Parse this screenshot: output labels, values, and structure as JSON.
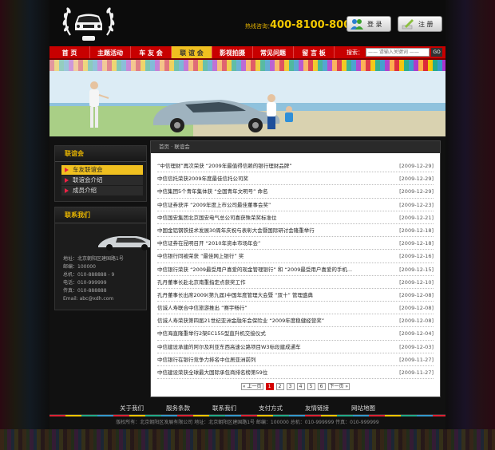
{
  "header": {
    "hotline_label": "热线咨询：",
    "hotline_number": "400-8100-8000",
    "login_label": "登 录",
    "register_label": "注 册",
    "logo_badge": "XDH"
  },
  "nav": {
    "items": [
      {
        "label": "首 页",
        "active": false
      },
      {
        "label": "主题活动",
        "active": false
      },
      {
        "label": "车 友 会",
        "active": false
      },
      {
        "label": "联 谊 会",
        "active": true
      },
      {
        "label": "影视拍摄",
        "active": false
      },
      {
        "label": "常见问题",
        "active": false
      },
      {
        "label": "留 言 板",
        "active": false
      }
    ],
    "search_label": "搜索：",
    "search_placeholder": "—— 请输入关键词 ——",
    "search_button": "GO"
  },
  "sidebar": {
    "section_title": "联谊会",
    "items": [
      {
        "label": "车友联谊会",
        "active": true
      },
      {
        "label": "联谊会介绍",
        "active": false
      },
      {
        "label": "成员介绍",
        "active": false
      }
    ],
    "contact_title": "联系我们",
    "contact_lines": [
      "地址：北京朝阳区建国路1号",
      "邮编：100000",
      "总机：010-888888 - 9",
      "电话：010-999999",
      "传真：010-888888",
      "Email: abc@xdh.com"
    ]
  },
  "main": {
    "breadcrumb": "首页 · 联谊会",
    "news": [
      {
        "title": "“中信理财”再次荣获 “2009年最值得信赖的银行理财品牌”",
        "date": "[2009-12-29]"
      },
      {
        "title": "中信信托荣获2009年度最佳信托公司奖",
        "date": "[2009-12-29]"
      },
      {
        "title": "中信集团5个青年集体获 “全国青年文明号” 命名",
        "date": "[2009-12-29]"
      },
      {
        "title": "中信证券获评 “2009年度上市公司最佳董事会奖”",
        "date": "[2009-12-23]"
      },
      {
        "title": "中信国安集团北京国安电气总公司喜获殊荣奖标准位",
        "date": "[2009-12-21]"
      },
      {
        "title": "中国金铝钢铁技术发展30周年庆祝与表彰大会暨国际研讨会隆重举行",
        "date": "[2009-12-18]"
      },
      {
        "title": "中信证券在昆明召开 “2010年资本市场年会”",
        "date": "[2009-12-18]"
      },
      {
        "title": "中信银行同被荣获 “最佳网上银行” 奖",
        "date": "[2009-12-16]"
      },
      {
        "title": "中信银行荣获 “2009最受用户喜爱的现金管理银行” 和 “2009最受用户喜爱的手机...",
        "date": "[2009-12-15]"
      },
      {
        "title": "孔丹董事长赴北京南重指定点获奖工作",
        "date": "[2009-12-10]"
      },
      {
        "title": "孔丹董事长出席2009(第九届)中国年度管理大会暨 “双十” 管理盛典",
        "date": "[2009-12-08]"
      },
      {
        "title": "信诚人寿联合中信旅游推出 “赛宇畅行”",
        "date": "[2009-12-08]"
      },
      {
        "title": "信诚人寿荣获第四届21世纪亚洲金融年会保险业 “2009年度稳健经营奖”",
        "date": "[2009-12-08]"
      },
      {
        "title": "中信海直隆重举行2架EC155型直升机交接仪式",
        "date": "[2009-12-04]"
      },
      {
        "title": "中信建设承建的阿尔及利亚东西高速公路项目W3标段建成通车",
        "date": "[2009-12-03]"
      },
      {
        "title": "中信银行在银行竞争力排名中位居亚洲前列",
        "date": "[2009-11-27]"
      },
      {
        "title": "中信建设荣获全球最大国际承包商排名榜第59位",
        "date": "[2009-11-27]"
      }
    ],
    "pager": {
      "prev": "« 上一页",
      "pages": [
        "1",
        "2",
        "3",
        "4",
        "5",
        "6"
      ],
      "current": "1",
      "next": "下一页 »"
    }
  },
  "footer": {
    "links": [
      "关于我们",
      "服务条款",
      "联系我们",
      "支付方式",
      "友情链接",
      "网站地图"
    ],
    "copyright": "版权所有：北京朝阳区发展有限公司  地址：北京朝阳区建国路1号  邮编：100000  总机：010-999999  传真：010-999999"
  },
  "colors": {
    "nav_red": "#c80000",
    "active_yellow": "#f0c020",
    "hotline_yellow": "#f3c800",
    "page_bg": "#111111"
  }
}
